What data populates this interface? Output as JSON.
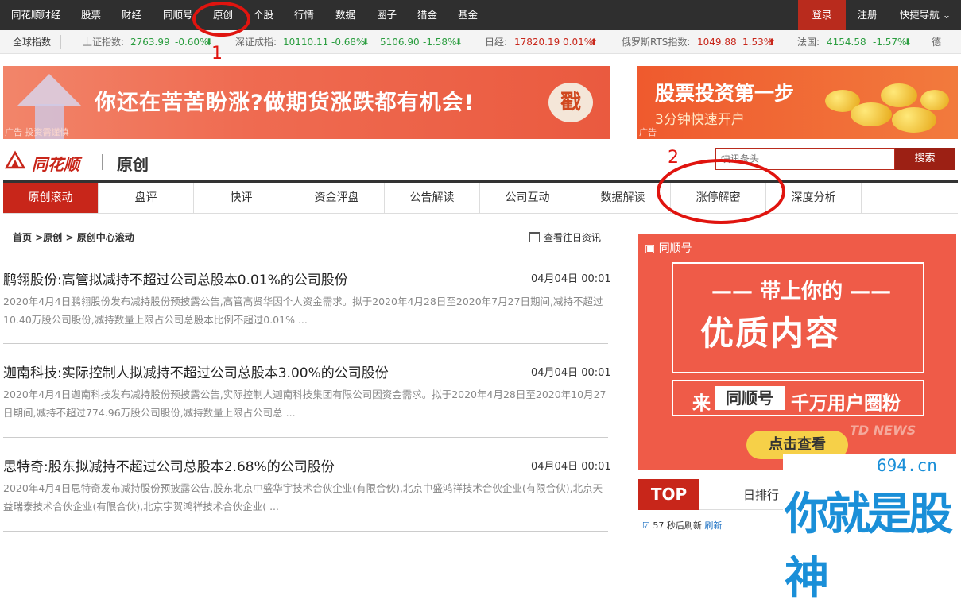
{
  "topnav": {
    "items": [
      "同花顺财经",
      "股票",
      "财经",
      "同顺号",
      "原创",
      "个股",
      "行情",
      "数据",
      "圈子",
      "猎金",
      "基金"
    ],
    "login": "登录",
    "register": "注册",
    "quick": "快捷导航"
  },
  "ticker": {
    "label": "全球指数",
    "entries": [
      {
        "name": "上证指数:",
        "value": "2763.99",
        "change": "-0.60%",
        "dir": "down"
      },
      {
        "name": "深证成指:",
        "value": "10110.11",
        "change": "-0.68%",
        "dir": "down"
      },
      {
        "name": "",
        "value": "5106.90",
        "change": "-1.58%",
        "dir": "down"
      },
      {
        "name": "日经:",
        "value": "17820.19",
        "change": "0.01%",
        "dir": "up"
      },
      {
        "name": "俄罗斯RTS指数:",
        "value": "1049.88",
        "change": "1.53%",
        "dir": "up"
      },
      {
        "name": "法国:",
        "value": "4154.58",
        "change": "-1.57%",
        "dir": "down"
      },
      {
        "name": "德",
        "value": "",
        "change": "",
        "dir": ""
      }
    ]
  },
  "ads": {
    "banner1": "你还在苦苦盼涨?做期货涨跌都有机会!",
    "banner1_stamp": "戳",
    "banner1_label": "广告  投资需谨慎",
    "banner2_title": "股票投资第一步",
    "banner2_sub": "3分钟快速开户",
    "banner2_label": "广告"
  },
  "header": {
    "logo": "同花顺",
    "section": "原创",
    "search_placeholder": "快讯条头",
    "search_button": "搜索"
  },
  "tabs": [
    "原创滚动",
    "盘评",
    "快评",
    "资金评盘",
    "公告解读",
    "公司互动",
    "数据解读",
    "涨停解密",
    "深度分析"
  ],
  "breadcrumb": {
    "home": "首页",
    "sep1": " >",
    "level1": "原创",
    "sep2": " > ",
    "level2": "原创中心滚动",
    "history": "查看往日资讯"
  },
  "annotations": {
    "num1": "1",
    "num2": "2"
  },
  "news": [
    {
      "title": "鹏翎股份:高管拟减持不超过公司总股本0.01%的公司股份",
      "time": "04月04日 00:01",
      "desc": "2020年4月4日鹏翎股份发布减持股份预披露公告,高管高贤华因个人资金需求。拟于2020年4月28日至2020年7月27日期间,减持不超过10.40万股公司股份,减持数量上限占公司总股本比例不超过0.01% ..."
    },
    {
      "title": "迦南科技:实际控制人拟减持不超过公司总股本3.00%的公司股份",
      "time": "04月04日 00:01",
      "desc": "2020年4月4日迦南科技发布减持股份预披露公告,实际控制人迦南科技集团有限公司因资金需求。拟于2020年4月28日至2020年10月27日期间,减持不超过774.96万股公司股份,减持数量上限占公司总 ..."
    },
    {
      "title": "思特奇:股东拟减持不超过公司总股本2.68%的公司股份",
      "time": "04月04日 00:01",
      "desc": "2020年4月4日思特奇发布减持股份预披露公告,股东北京中盛华宇技术合伙企业(有限合伙),北京中盛鸿祥技术合伙企业(有限合伙),北京天益瑞泰技术合伙企业(有限合伙),北京宇贺鸿祥技术合伙企业( ..."
    }
  ],
  "promo": {
    "brand": "同顺号",
    "line1": "带上你的",
    "line2": "优质内容",
    "lead": "来",
    "highlight": "同顺号",
    "tail": "千万用户圈粉",
    "cta": "点击查看",
    "watermark": "TD NEWS"
  },
  "top": {
    "badge": "TOP",
    "rank": "日排行",
    "item_count": "57",
    "item_text": "秒后刷新",
    "item_link": "刷新"
  },
  "watermark": {
    "site": "694.cn",
    "big": "你就是股神"
  }
}
